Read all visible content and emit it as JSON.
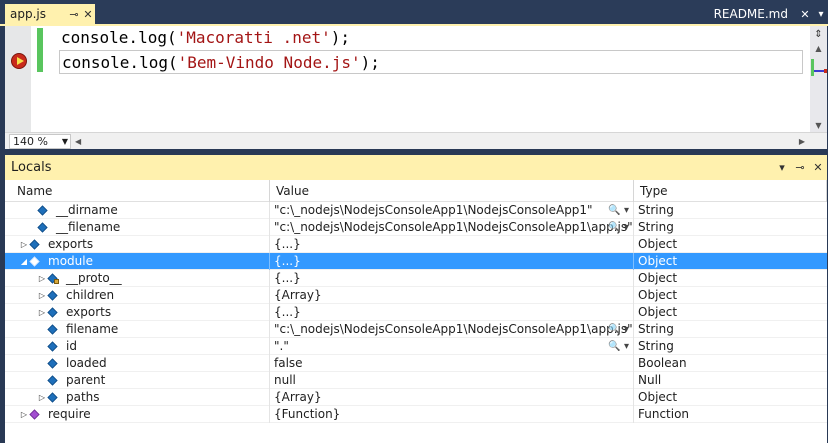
{
  "tabs": {
    "active_label": "app.js",
    "pin_glyph": "⊸",
    "close_glyph": "✕",
    "right_label": "README.md",
    "right_close_glyph": "✕",
    "menu_glyph": "▾"
  },
  "editor": {
    "lines": [
      {
        "prefix": "console.log(",
        "string": "'Macoratti .net'",
        "suffix": ");"
      },
      {
        "prefix": "console.log(",
        "string": "'Bem-Vindo Node.js'",
        "suffix": ");"
      }
    ],
    "zoom": "140 %"
  },
  "locals": {
    "title": "Locals",
    "controls": {
      "dropdown": "▾",
      "pin": "⊸",
      "close": "✕"
    },
    "columns": {
      "name": "Name",
      "value": "Value",
      "type": "Type"
    },
    "rows": [
      {
        "name": "__dirname",
        "value": "\"c:\\_nodejs\\NodejsConsoleApp1\\NodejsConsoleApp1\"",
        "type": "String",
        "tools": "🔍 ▾"
      },
      {
        "name": "__filename",
        "value": "\"c:\\_nodejs\\NodejsConsoleApp1\\NodejsConsoleApp1\\app.js\"",
        "type": "String",
        "tools": "🔍 ▾"
      },
      {
        "name": "exports",
        "value": "{...}",
        "type": "Object"
      },
      {
        "name": "module",
        "value": "{...}",
        "type": "Object"
      },
      {
        "name": "__proto__",
        "value": "{...}",
        "type": "Object"
      },
      {
        "name": "children",
        "value": "{Array}",
        "type": "Object"
      },
      {
        "name": "exports",
        "value": "{...}",
        "type": "Object"
      },
      {
        "name": "filename",
        "value": "\"c:\\_nodejs\\NodejsConsoleApp1\\NodejsConsoleApp1\\app.js\"",
        "type": "String",
        "tools": "🔍 ▾"
      },
      {
        "name": "id",
        "value": "\".\"",
        "type": "String",
        "tools": "🔍 ▾"
      },
      {
        "name": "loaded",
        "value": "false",
        "type": "Boolean"
      },
      {
        "name": "parent",
        "value": "null",
        "type": "Null"
      },
      {
        "name": "paths",
        "value": "{Array}",
        "type": "Object"
      },
      {
        "name": "require",
        "value": "{Function}",
        "type": "Function"
      }
    ]
  },
  "colors": {
    "accent": "#fff1ae",
    "frame": "#2b3c59",
    "selection": "#3399ff",
    "string": "#a31515"
  }
}
